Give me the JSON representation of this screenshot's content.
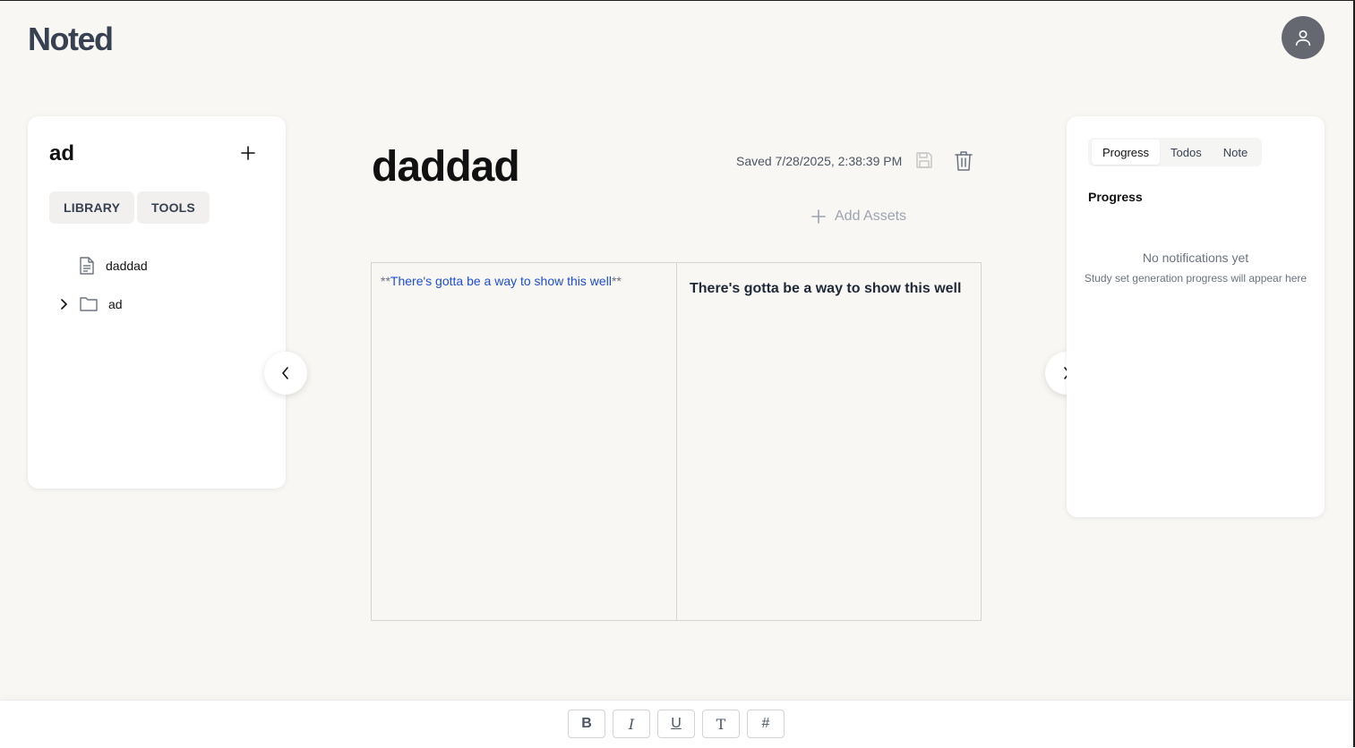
{
  "app": {
    "brand": "Noted"
  },
  "left_panel": {
    "title": "ad",
    "tabs": [
      "LIBRARY",
      "TOOLS"
    ],
    "tree": [
      {
        "type": "file",
        "label": "daddad"
      },
      {
        "type": "folder",
        "label": "ad",
        "collapsed": true
      }
    ]
  },
  "document": {
    "title": "daddad",
    "saved_status": "Saved 7/28/2025, 2:38:39 PM",
    "add_assets_label": "Add Assets",
    "source_prefix": "**",
    "source_text": "There's gotta be a way to show this well",
    "source_suffix": "**",
    "preview_text": "There's gotta be a way to show this well"
  },
  "right_panel": {
    "tabs": [
      "Progress",
      "Todos",
      "Note"
    ],
    "active_tab": "Progress",
    "heading": "Progress",
    "empty_title": "No notifications yet",
    "empty_subtitle": "Study set generation progress will appear here"
  },
  "toolbar": {
    "bold": "B",
    "italic": "I",
    "underline": "U",
    "text": "T",
    "heading": "#"
  },
  "colors": {
    "background": "#f8f7f4",
    "brand": "#374151",
    "avatar": "#656870",
    "link": "#1d4ed8"
  }
}
